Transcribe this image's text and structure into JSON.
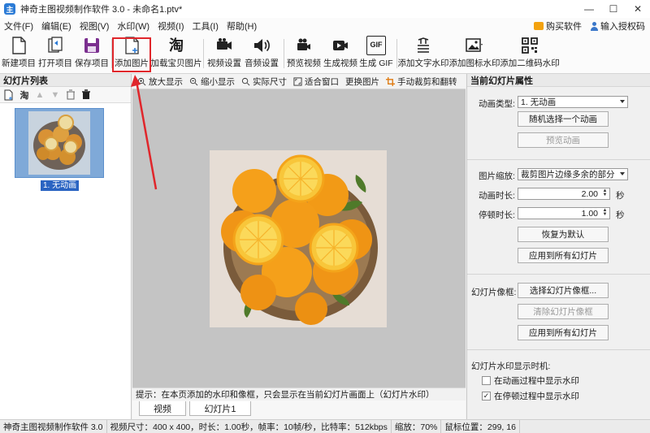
{
  "app": {
    "title": "神奇主图视频制作软件 3.0 - 未命名1.ptv*",
    "icon_letter": "主"
  },
  "menu": {
    "items": [
      "文件(F)",
      "编辑(E)",
      "视图(V)",
      "水印(W)",
      "视频(I)",
      "工具(I)",
      "帮助(H)"
    ],
    "buy": "购买软件",
    "license": "输入授权码"
  },
  "toolbar": {
    "new_project": "新建项目",
    "open_project": "打开项目",
    "save_project": "保存项目",
    "add_image": "添加图片",
    "add_baobei": "加载宝贝图片",
    "video_settings": "视频设置",
    "audio_settings": "音频设置",
    "preview_video": "预览视频",
    "generate_video": "生成视频",
    "generate_gif": "生成 GIF",
    "add_text_watermark": "添加文字水印",
    "add_image_watermark": "添加图标水印",
    "add_qr_watermark": "添加二维码水印",
    "baobei_glyph": "淘",
    "gif_glyph": "GIF"
  },
  "left_panel": {
    "title": "幻灯片列表",
    "taobao_glyph": "淘",
    "slide_label": "1. 无动画"
  },
  "center": {
    "zoom_in": "放大显示",
    "zoom_out": "缩小显示",
    "actual_size": "实际尺寸",
    "fit_window": "适合窗口",
    "replace_image": "更换图片",
    "crop_flip": "手动裁剪和翻转",
    "hint": "提示：在本页添加的水印和像框，只会显示在当前幻灯片画面上（幻灯片水印）",
    "tab_video": "视频",
    "tab_slide": "幻灯片1"
  },
  "right_panel": {
    "title": "当前幻灯片属性",
    "anim_type_label": "动画类型:",
    "anim_type_value": "1. 无动画",
    "random_anim": "随机选择一个动画",
    "preview_anim": "预览动画",
    "image_scale_label": "图片缩放:",
    "image_scale_value": "裁剪图片边缘多余的部分",
    "anim_duration_label": "动画时长:",
    "anim_duration_value": "2.00",
    "pause_duration_label": "停顿时长:",
    "pause_duration_value": "1.00",
    "seconds": "秒",
    "reset_default": "恢复为默认",
    "apply_all_1": "应用到所有幻灯片",
    "frame_label": "幻灯片像框:",
    "select_frame": "选择幻灯片像框...",
    "clear_frame": "清除幻灯片像框",
    "apply_all_2": "应用到所有幻灯片",
    "watermark_time_label": "幻灯片水印显示时机:",
    "show_during_anim": "在动画过程中显示水印",
    "show_during_pause": "在停顿过程中显示水印",
    "show_during_anim_checked": false,
    "show_during_pause_checked": true
  },
  "statusbar": {
    "app": "神奇主图视频制作软件 3.0",
    "video_info": "视频尺寸：400 x 400，时长：1.00秒，帧率：10帧/秒，比特率：512kbps",
    "zoom": "缩放：70%",
    "mouse_pos": "鼠标位置：299, 16"
  },
  "colors": {
    "accent_blue": "#2a64c2",
    "highlight_red": "#e0262b",
    "orange": "#f59a0c"
  }
}
